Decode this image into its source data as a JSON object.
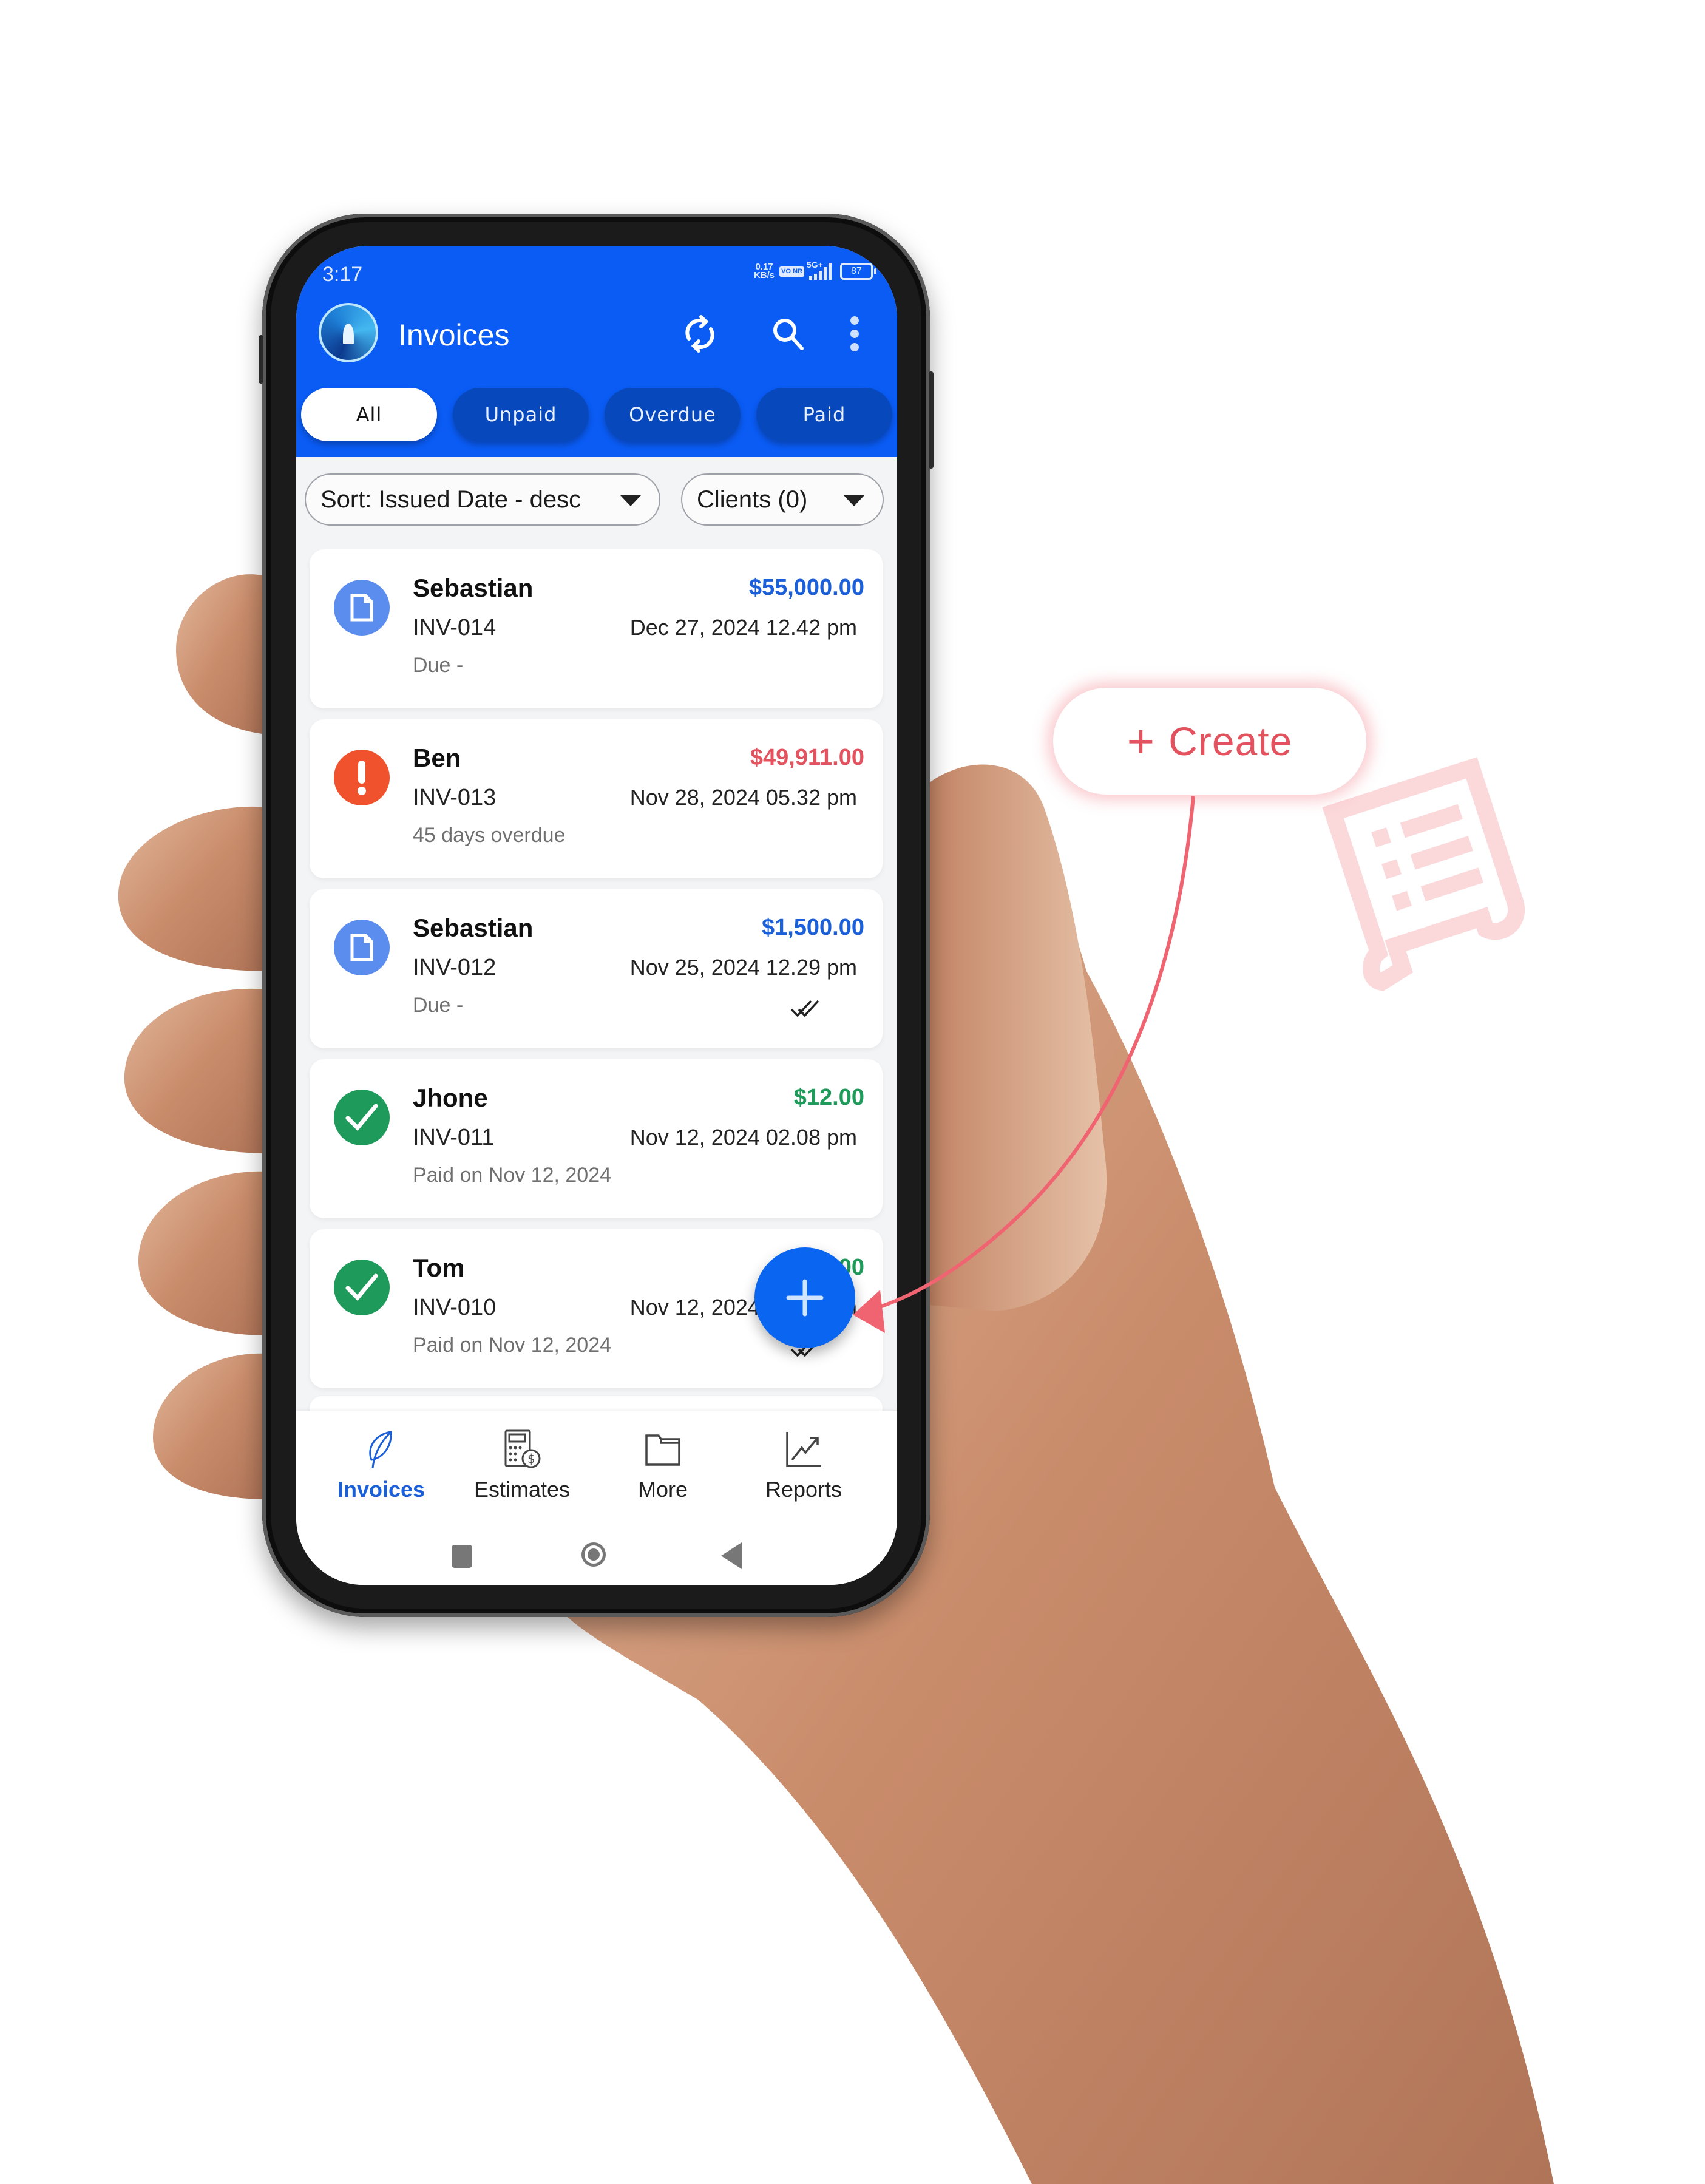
{
  "status_bar": {
    "time": "3:17",
    "net_speed_value": "0.17",
    "net_speed_unit": "KB/s",
    "volte": "VO NR",
    "network": "5G+",
    "battery": "87"
  },
  "app_bar": {
    "title": "Invoices",
    "icons": [
      "sync-icon",
      "search-icon",
      "more-vert-icon"
    ]
  },
  "tabs": [
    {
      "label": "All",
      "active": true
    },
    {
      "label": "Unpaid",
      "active": false
    },
    {
      "label": "Overdue",
      "active": false
    },
    {
      "label": "Paid",
      "active": false
    }
  ],
  "filters": {
    "sort_label": "Sort: Issued Date - desc",
    "clients_label": "Clients (0)"
  },
  "colors": {
    "primary": "#0a5cf5",
    "amount_due": "#1b5fd9",
    "amount_overdue": "#e2535f",
    "amount_paid": "#1e9a5a",
    "callout": "#e2535f"
  },
  "invoices": [
    {
      "client": "Sebastian",
      "number": "INV-014",
      "amount": "$55,000.00",
      "date": "Dec 27, 2024 12.42 pm",
      "status_text": "Due -",
      "status": "due",
      "sent_ticks": false
    },
    {
      "client": "Ben",
      "number": "INV-013",
      "amount": "$49,911.00",
      "date": "Nov 28, 2024 05.32 pm",
      "status_text": "45 days overdue",
      "status": "overdue",
      "sent_ticks": false
    },
    {
      "client": "Sebastian",
      "number": "INV-012",
      "amount": "$1,500.00",
      "date": "Nov 25, 2024 12.29 pm",
      "status_text": "Due -",
      "status": "due",
      "sent_ticks": true
    },
    {
      "client": "Jhone",
      "number": "INV-011",
      "amount": "$12.00",
      "date": "Nov 12, 2024 02.08 pm",
      "status_text": "Paid on Nov 12, 2024",
      "status": "paid",
      "sent_ticks": false
    },
    {
      "client": "Tom",
      "number": "INV-010",
      "amount": "$12.00",
      "date": "Nov 12, 2024 02.08 pm",
      "status_text": "Paid on Nov 12, 2024",
      "status": "paid",
      "sent_ticks": true
    }
  ],
  "fab": {
    "icon": "plus-icon"
  },
  "bottom_nav": [
    {
      "label": "Invoices",
      "icon": "leaf-icon",
      "active": true
    },
    {
      "label": "Estimates",
      "icon": "calculator-dollar-icon",
      "active": false
    },
    {
      "label": "More",
      "icon": "folder-icon",
      "active": false
    },
    {
      "label": "Reports",
      "icon": "trending-chart-icon",
      "active": false
    }
  ],
  "system_nav": [
    "recents-button",
    "home-button",
    "back-button"
  ],
  "callout": {
    "plus": "+",
    "label": "Create"
  }
}
